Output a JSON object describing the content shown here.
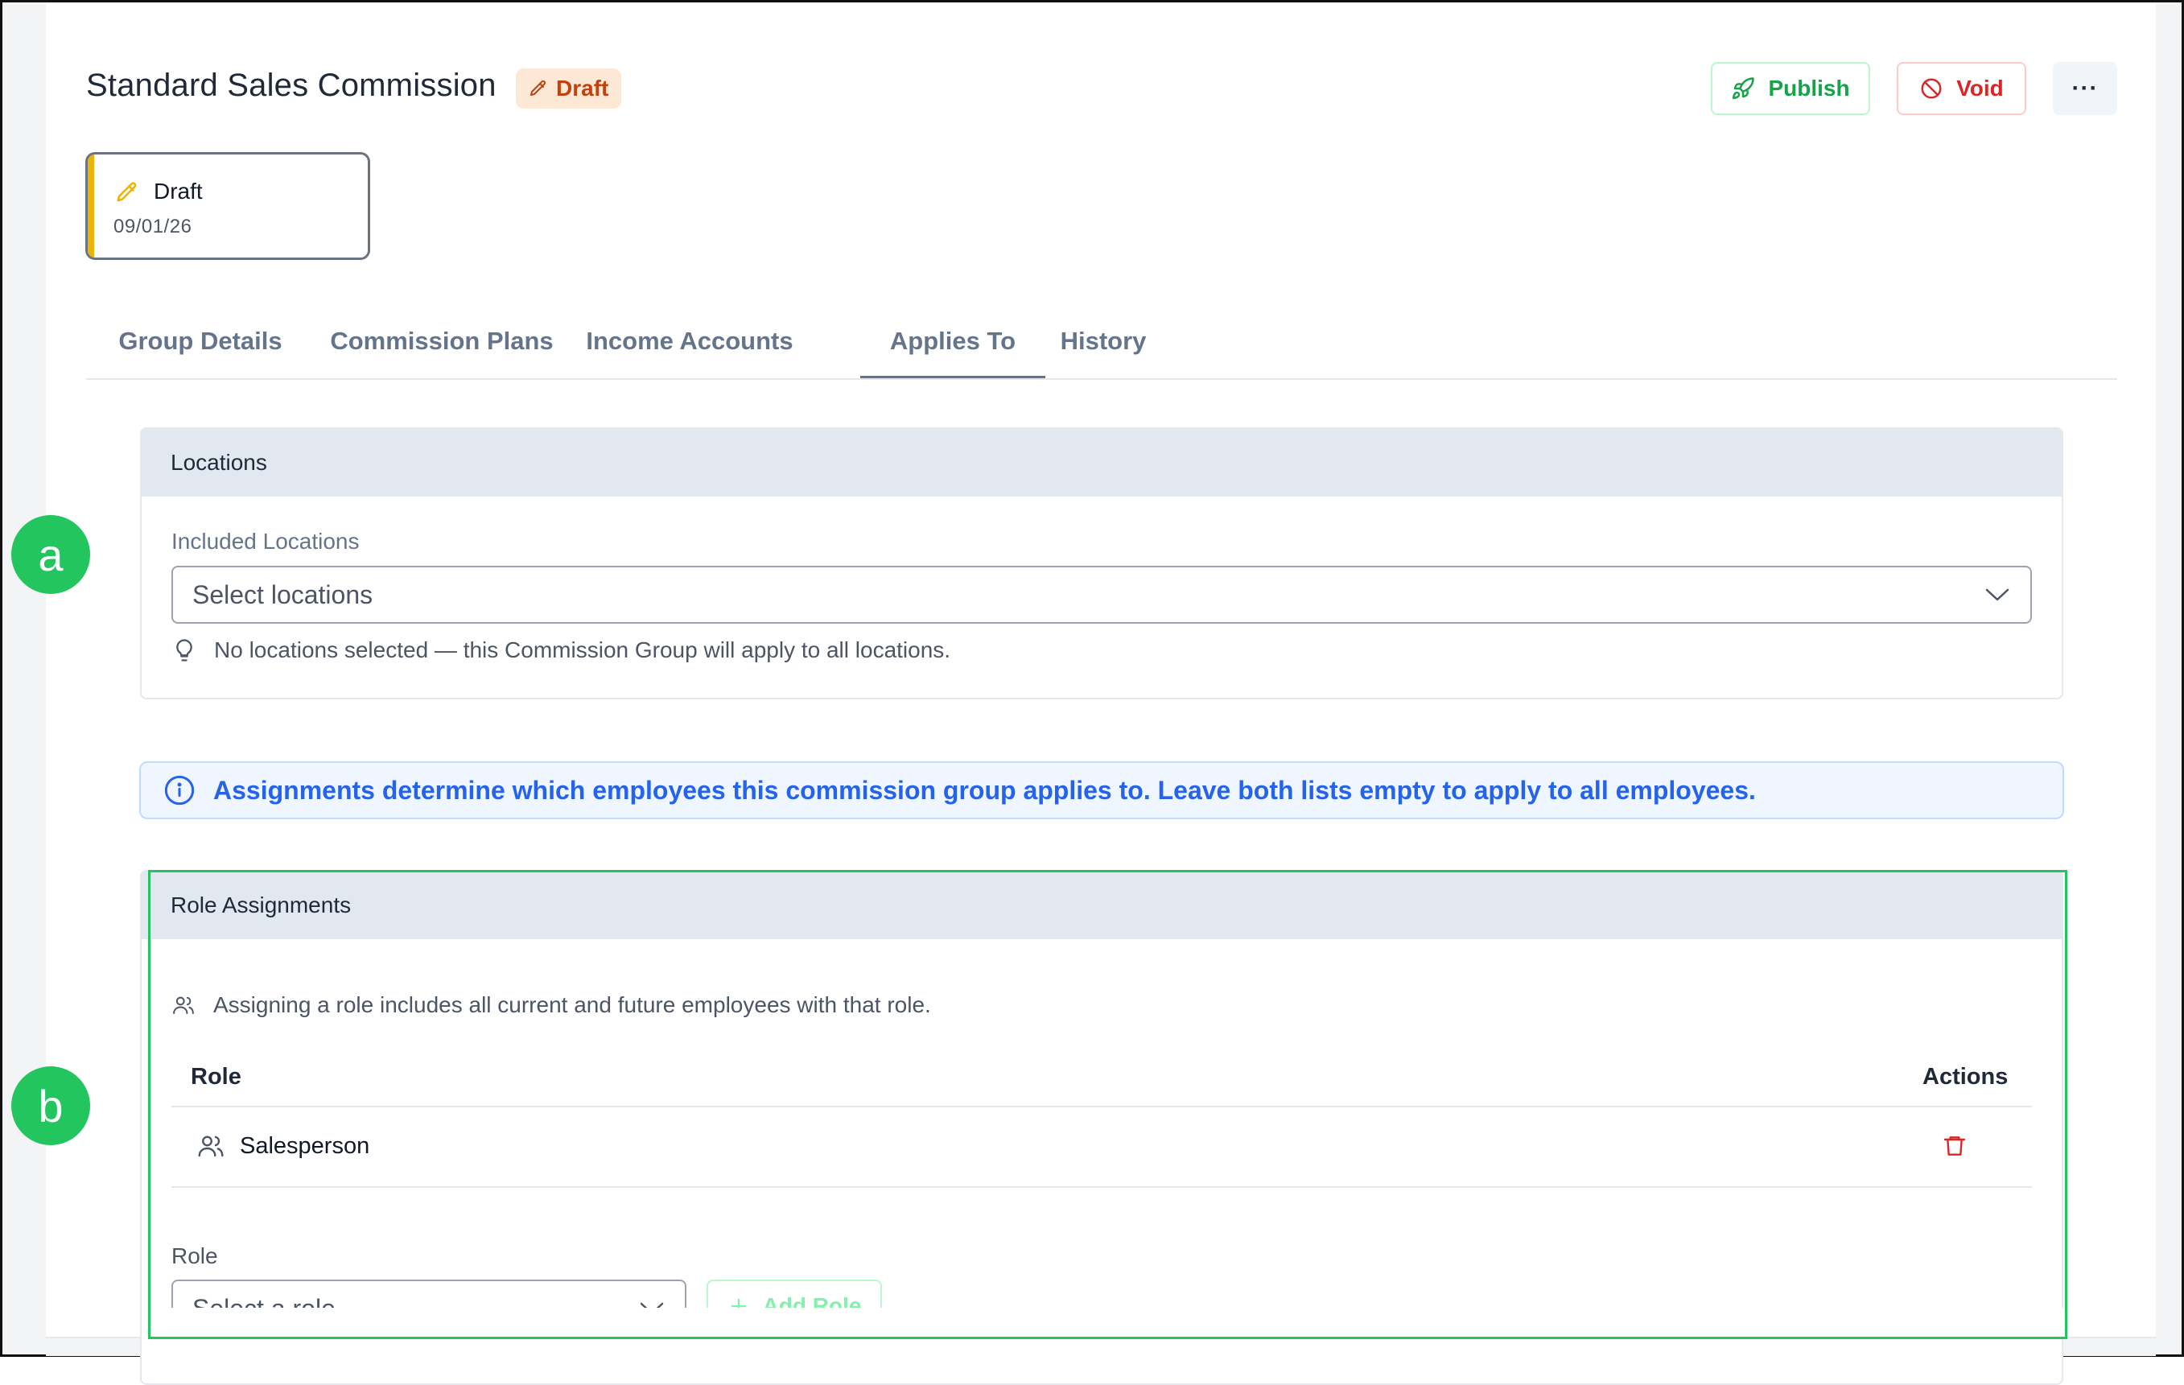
{
  "header": {
    "title": "Standard Sales Commission",
    "status_badge": "Draft",
    "actions": {
      "publish": "Publish",
      "void": "Void",
      "more": "···"
    }
  },
  "status_card": {
    "label": "Draft",
    "date": "09/01/26"
  },
  "tabs": [
    {
      "label": "Group Details",
      "active": false
    },
    {
      "label": "Commission Plans",
      "active": false
    },
    {
      "label": "Income Accounts",
      "active": false
    },
    {
      "label": "Applies To",
      "active": true
    },
    {
      "label": "History",
      "active": false
    }
  ],
  "locations": {
    "header": "Locations",
    "field_label": "Included Locations",
    "placeholder": "Select locations",
    "hint": "No locations selected — this Commission Group will apply to all locations."
  },
  "info_banner": "Assignments determine which employees this commission group applies to. Leave both lists empty to apply to all employees.",
  "role_assignments": {
    "header": "Role Assignments",
    "hint": "Assigning a role includes all current and future employees with that role.",
    "columns": {
      "role": "Role",
      "actions": "Actions"
    },
    "rows": [
      {
        "role": "Salesperson"
      }
    ],
    "add_label": "Role",
    "add_placeholder": "Select a role",
    "add_button": "Add Role"
  },
  "markers": {
    "a": "a",
    "b": "b"
  },
  "colors": {
    "accent_green": "#22c55e",
    "draft_orange": "#c2410c",
    "void_red": "#dc2626",
    "info_blue": "#2563eb",
    "draft_yellow": "#eab308"
  }
}
